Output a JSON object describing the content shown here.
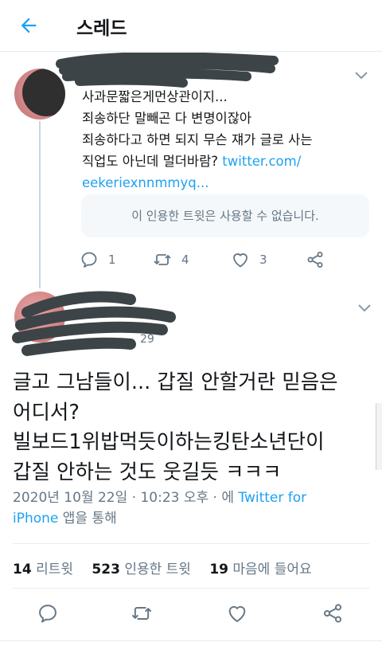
{
  "header": {
    "title": "스레드",
    "back_icon": "arrow-left-icon"
  },
  "colors": {
    "accent": "#1da1f2",
    "muted": "#657786",
    "text": "#14171a",
    "divider": "#e6ecf0"
  },
  "parent_tweet": {
    "lines": [
      "사과문짧은게먼상관이지...",
      "죄송하단 말빼곤 다 변명이잖아",
      "죄송하다고 하면 되지 무슨 쟤가 글로 사는",
      "직업도 아닌데 멀더바람? "
    ],
    "link_part1": "twitter.com/",
    "link_part2": "eekeriexnnmmyq...",
    "quote_unavailable": "이 인용한 트윗은 사용할 수 없습니다.",
    "replies": "1",
    "retweets": "4",
    "likes": "3"
  },
  "main_tweet": {
    "handle_fragment": "29",
    "lines": [
      "글고 그남들이... 갑질 안할거란 믿음은",
      "어디서?",
      "빌보드1위밥먹듯이하는킹탄소년단이",
      "갑질 안하는 것도 웃길듯 ㅋㅋㅋ"
    ],
    "timestamp": "2020년 10월 22일 · 10:23 오후 · 에 ",
    "via_part1": "Twitter for",
    "via_part2": "iPhone",
    "via_suffix": " 앱을 통해"
  },
  "stats": {
    "retweets_count": "14",
    "retweets_label": "리트윗",
    "quotes_count": "523",
    "quotes_label": "인용한 트윗",
    "likes_count": "19",
    "likes_label": "마음에 들어요"
  }
}
